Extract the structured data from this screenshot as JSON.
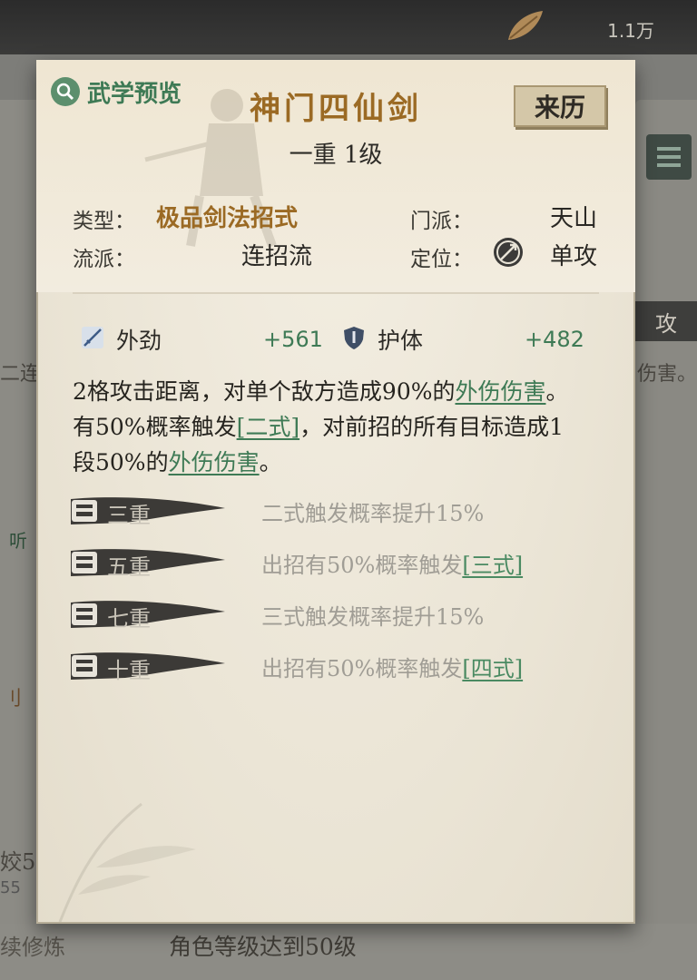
{
  "header": {
    "currency_amount": "1.1万"
  },
  "panel": {
    "preview_label": "武学预览",
    "skill_name": "神门四仙剑",
    "skill_level": "一重 1级",
    "origin_button": "来历",
    "info": {
      "type_label": "类型：",
      "type_value": "极品剑法招式",
      "sect_label": "门派：",
      "sect_value": "天山",
      "school_label": "流派：",
      "school_value": "连招流",
      "role_label": "定位：",
      "role_value": "单攻"
    },
    "stats": [
      {
        "label": "外劲",
        "value": "+561",
        "icon": "sword-icon"
      },
      {
        "label": "护体",
        "value": "+482",
        "icon": "shield-icon"
      }
    ],
    "description": {
      "p1": "2格攻击距离，对单个敌方造成90%的",
      "l1": "外伤伤害",
      "p2": "。有50%概率触发",
      "l2": "[二式]",
      "p3": "，对前招的所有目标造成1段50%的",
      "l3": "外伤伤害",
      "p4": "。"
    },
    "tiers": [
      {
        "name": "三重",
        "text": "二式触发概率提升15%",
        "link": ""
      },
      {
        "name": "五重",
        "text": "出招有50%概率触发",
        "link": "[三式]"
      },
      {
        "name": "七重",
        "text": "三式触发概率提升15%",
        "link": ""
      },
      {
        "name": "十重",
        "text": "出招有50%概率触发",
        "link": "[四式]"
      }
    ]
  },
  "background": {
    "attack_tag": "攻",
    "left_fragment_1": "二连",
    "right_fragment_1": "伤害。",
    "left_fragment_2": "听",
    "left_fragment_3": "刂",
    "left_fragment_4": "姣5",
    "left_fragment_5": "55",
    "left_fragment_6": "续修炼",
    "requirement": "角色等级达到50级"
  },
  "colors": {
    "accent_green": "#3e7a55",
    "accent_gold": "#9b6a24",
    "parchment": "#ebe5d6"
  }
}
